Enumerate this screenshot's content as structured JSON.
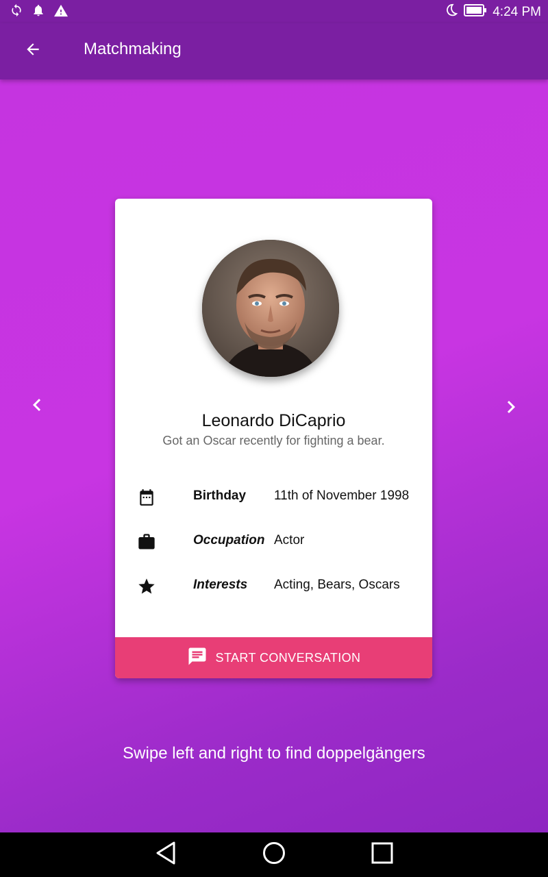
{
  "status_bar": {
    "time": "4:24 PM",
    "icons": [
      "sync-icon",
      "notification-bell-icon",
      "warning-icon",
      "do-not-disturb-moon-icon",
      "battery-full-icon"
    ]
  },
  "app_bar": {
    "title": "Matchmaking",
    "back_icon": "arrow-back-icon"
  },
  "carousel": {
    "prev_icon": "chevron-left-icon",
    "next_icon": "chevron-right-icon"
  },
  "profile": {
    "name": "Leonardo DiCaprio",
    "tagline": "Got an Oscar recently for fighting a bear.",
    "details": [
      {
        "icon": "calendar-icon",
        "label": "Birthday",
        "value": "11th of November 1998"
      },
      {
        "icon": "briefcase-icon",
        "label": "Occupation",
        "value": "Actor"
      },
      {
        "icon": "star-icon",
        "label": "Interests",
        "value": "Acting, Bears, Oscars"
      }
    ],
    "cta_label": "START CONVERSATION",
    "cta_icon": "chat-message-icon"
  },
  "hint": "Swipe left and right to find doppelgängers",
  "system_nav": {
    "back": "nav-back-icon",
    "home": "nav-home-icon",
    "recents": "nav-recents-icon"
  },
  "colors": {
    "app_bar": "#7b1fa2",
    "background_gradient_start": "#c534e0",
    "background_gradient_end": "#8e26c1",
    "cta": "#e83e76",
    "card": "#ffffff"
  }
}
